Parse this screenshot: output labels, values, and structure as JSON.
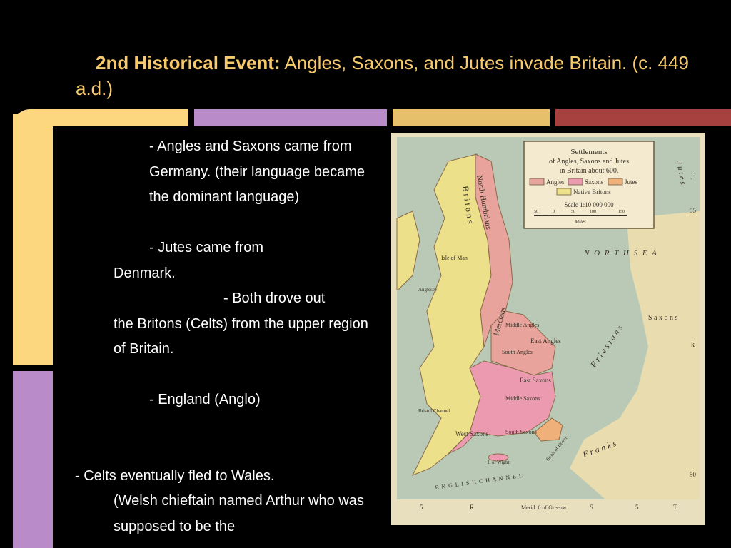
{
  "slide": {
    "title_bold": "2nd Historical Event:",
    "title_rest": " Angles, Saxons, and Jutes invade Britain. (c. 449 a.d.)",
    "body": [
      "- Angles and Saxons came from Germany. (their language became the dominant language)",
      "- Jutes came from",
      "Denmark.",
      "- Both drove out",
      "the Britons (Celts) from the upper region of Britain.",
      "- England (Anglo)",
      "- Celts eventually fled to Wales.",
      "(Welsh chieftain named Arthur who was supposed to be the"
    ]
  },
  "colors": {
    "title": "#f7c96a",
    "frame_orange": "#fdd77f",
    "frame_purple": "#b98bc9",
    "frame_gold": "#e6c06a",
    "frame_red": "#a6413f"
  },
  "map": {
    "legend": {
      "title_line1": "Settlements",
      "title_line2": "of Angles, Saxons and Jutes",
      "title_line3": "in Britain about 600.",
      "items": [
        "Angles",
        "Saxons",
        "Jutes",
        "Native Britons"
      ],
      "scale": "Scale 1:10 000 000",
      "ticks": [
        "50",
        "0",
        "50",
        "100",
        "150"
      ],
      "unit": "Miles"
    },
    "labels": {
      "north_sea": "N O R T H   S E A",
      "north_humbrians": "North Humbrians",
      "britons": "B r i t o n s",
      "mercians": "Mercians",
      "east_angles": "East Angles",
      "east_saxons": "East Saxons",
      "south_saxons": "South Saxons",
      "west_saxons": "West Saxons",
      "middle_saxons": "Middle Saxons",
      "middle_angles": "Middle Angles",
      "south_angles": "South Angles",
      "isle_of_man": "Isle of Man",
      "anglesey": "Anglesey",
      "bristol_channel": "Bristol Channel",
      "isle_of_wight": "I. of Wight",
      "english_channel": "E N G L I S H   C H A N N E L",
      "strait_of_dover": "Strait of Dover",
      "frisians": "F r i e s i a n s",
      "saxons_continent": "S a x o n s",
      "franks": "F r a n k s",
      "jutes": "J u t e s",
      "lat_55": "55",
      "lat_50": "50",
      "long_5_left": "5",
      "long_r": "R",
      "meridian": "Merid. 0 of Greenw.",
      "long_s": "S",
      "long_5_right": "5",
      "long_t": "T",
      "grid_j": "j",
      "grid_k": "k"
    }
  }
}
